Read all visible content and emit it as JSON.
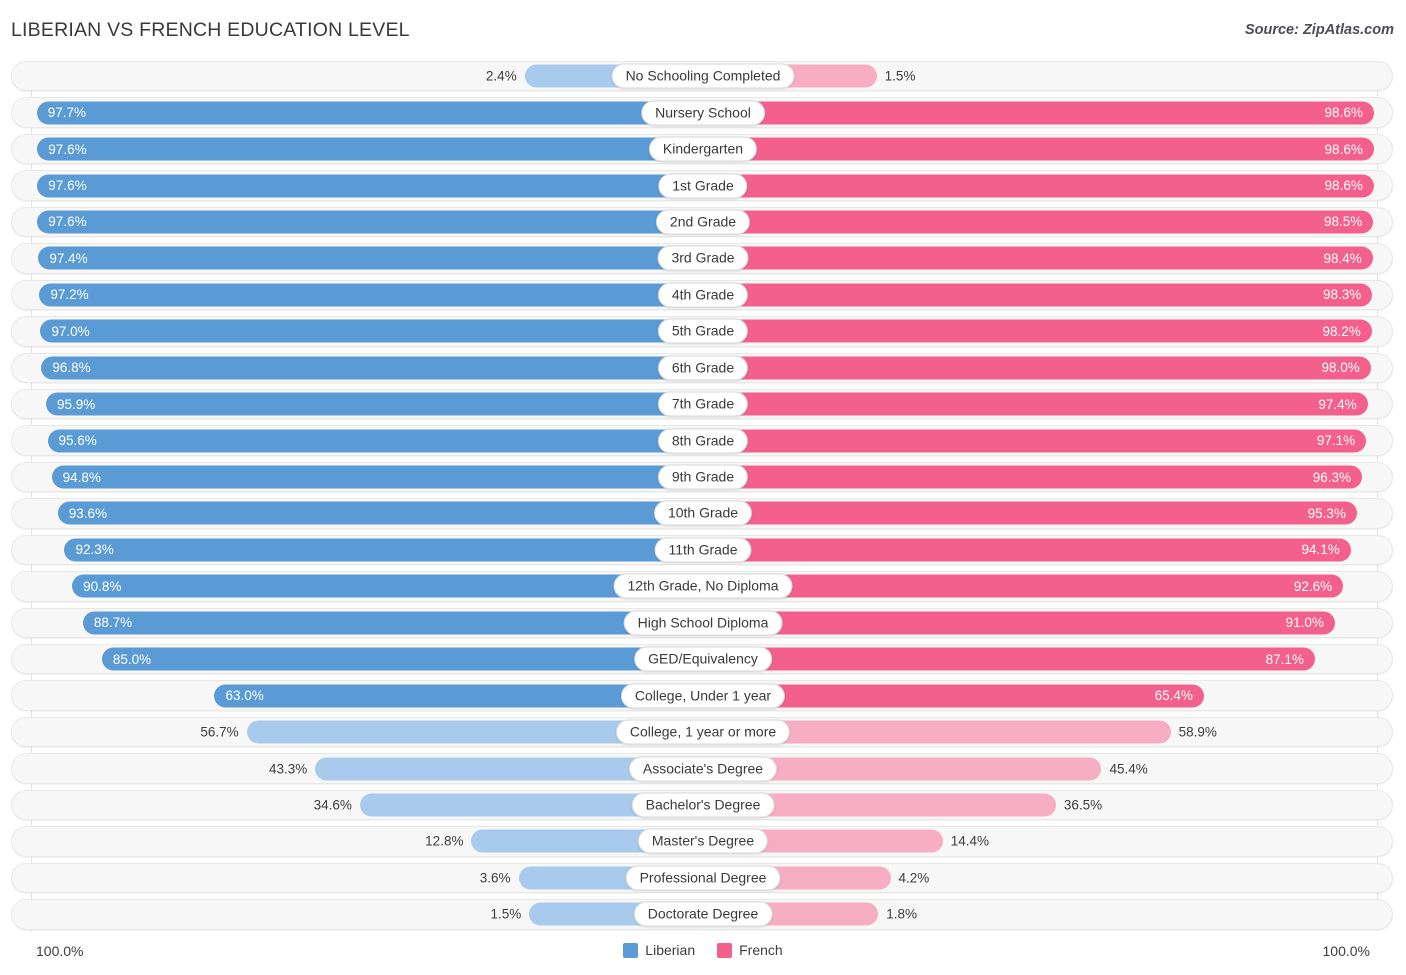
{
  "header": {
    "title": "LIBERIAN VS FRENCH EDUCATION LEVEL",
    "source": "Source: ZipAtlas.com"
  },
  "axis": {
    "left_max": "100.0%",
    "right_max": "100.0%"
  },
  "legend": {
    "items": [
      {
        "label": "Liberian",
        "color": "#5b9bd5"
      },
      {
        "label": "French",
        "color": "#f4608e"
      }
    ]
  },
  "colors": {
    "blue_strong": "#5b9bd5",
    "blue_light": "#a8cbed",
    "pink_strong": "#f4608e",
    "pink_light": "#f7aec4",
    "track": "#f7f7f7",
    "track_border": "#e8e8e8",
    "gridline": "#e2e2e2",
    "text": "#3d3d3d"
  },
  "chart_data": {
    "type": "bar",
    "subtype": "diverging-bidirectional",
    "title": "LIBERIAN VS FRENCH EDUCATION LEVEL",
    "xlabel": "",
    "ylabel": "",
    "xlim": [
      0,
      100
    ],
    "grid": true,
    "legend_position": "bottom-center",
    "categories": [
      "No Schooling Completed",
      "Nursery School",
      "Kindergarten",
      "1st Grade",
      "2nd Grade",
      "3rd Grade",
      "4th Grade",
      "5th Grade",
      "6th Grade",
      "7th Grade",
      "8th Grade",
      "9th Grade",
      "10th Grade",
      "11th Grade",
      "12th Grade, No Diploma",
      "High School Diploma",
      "GED/Equivalency",
      "College, Under 1 year",
      "College, 1 year or more",
      "Associate's Degree",
      "Bachelor's Degree",
      "Master's Degree",
      "Professional Degree",
      "Doctorate Degree"
    ],
    "series": [
      {
        "name": "Liberian",
        "color": "#5b9bd5",
        "side": "left",
        "values": [
          2.4,
          97.7,
          97.6,
          97.6,
          97.6,
          97.4,
          97.2,
          97.0,
          96.8,
          95.9,
          95.6,
          94.8,
          93.6,
          92.3,
          90.8,
          88.7,
          85.0,
          63.0,
          56.7,
          43.3,
          34.6,
          12.8,
          3.6,
          1.5
        ],
        "labels": [
          "2.4%",
          "97.7%",
          "97.6%",
          "97.6%",
          "97.6%",
          "97.4%",
          "97.2%",
          "97.0%",
          "96.8%",
          "95.9%",
          "95.6%",
          "94.8%",
          "93.6%",
          "92.3%",
          "90.8%",
          "88.7%",
          "85.0%",
          "63.0%",
          "56.7%",
          "43.3%",
          "34.6%",
          "12.8%",
          "3.6%",
          "1.5%"
        ]
      },
      {
        "name": "French",
        "color": "#f4608e",
        "side": "right",
        "values": [
          1.5,
          98.6,
          98.6,
          98.6,
          98.5,
          98.4,
          98.3,
          98.2,
          98.0,
          97.4,
          97.1,
          96.3,
          95.3,
          94.1,
          92.6,
          91.0,
          87.1,
          65.4,
          58.9,
          45.4,
          36.5,
          14.4,
          4.2,
          1.8
        ],
        "labels": [
          "1.5%",
          "98.6%",
          "98.6%",
          "98.6%",
          "98.5%",
          "98.4%",
          "98.3%",
          "98.2%",
          "98.0%",
          "97.4%",
          "97.1%",
          "96.3%",
          "95.3%",
          "94.1%",
          "92.6%",
          "91.0%",
          "87.1%",
          "65.4%",
          "58.9%",
          "45.4%",
          "36.5%",
          "14.4%",
          "4.2%",
          "1.8%"
        ]
      }
    ]
  }
}
